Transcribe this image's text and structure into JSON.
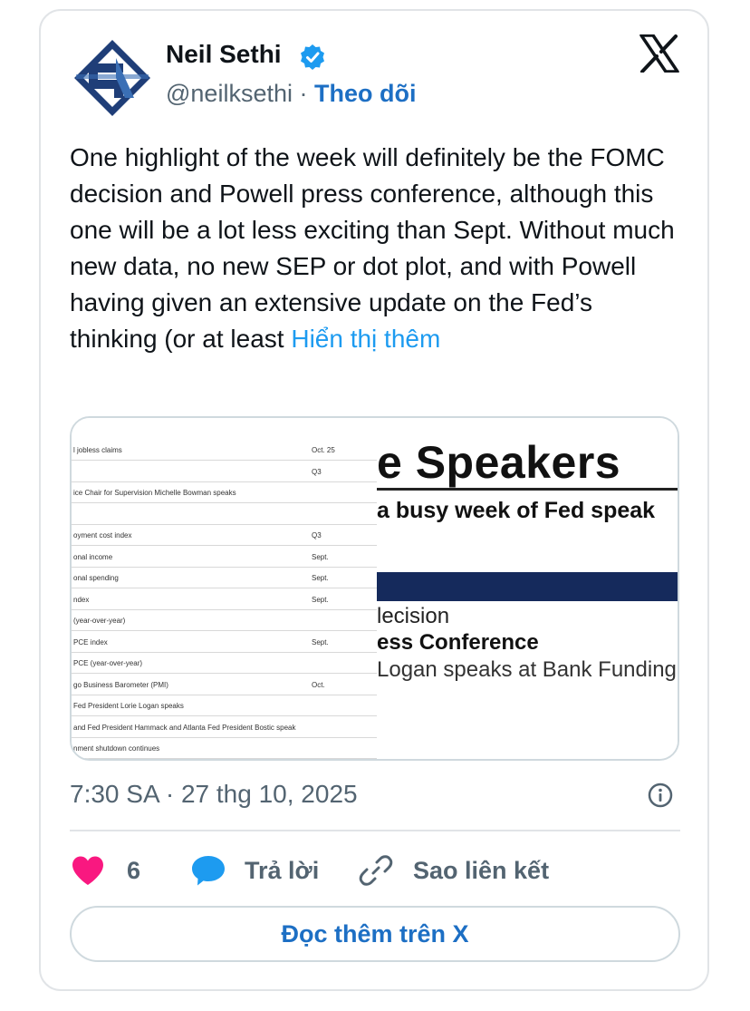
{
  "author": {
    "name": "Neil Sethi",
    "handle": "@neilksethi",
    "separator": "·",
    "follow_label": "Theo dõi"
  },
  "tweet": {
    "text": "One highlight of the week will definitely be the FOMC decision and Powell press conference, although this one will be a lot less exciting than Sept. Without much new data, no new SEP or dot plot, and with Powell having given an extensive update on the Fed’s thinking (or at least ",
    "show_more": "Hiển thị thêm"
  },
  "media": {
    "table_rows": [
      {
        "label": "l jobless claims",
        "period": "Oct. 25"
      },
      {
        "label": "",
        "period": "Q3"
      },
      {
        "label": "ice Chair for Supervision Michelle Bowman speaks",
        "period": ""
      },
      {
        "label": "",
        "period": ""
      },
      {
        "label": "oyment cost index",
        "period": "Q3"
      },
      {
        "label": "onal income",
        "period": "Sept."
      },
      {
        "label": "onal spending",
        "period": "Sept."
      },
      {
        "label": "ndex",
        "period": "Sept."
      },
      {
        "label": "(year-over-year)",
        "period": ""
      },
      {
        "label": "PCE index",
        "period": "Sept."
      },
      {
        "label": "PCE (year-over-year)",
        "period": ""
      },
      {
        "label": "go Business Barometer (PMI)",
        "period": "Oct."
      },
      {
        "label": "Fed President Lorie Logan speaks",
        "period": ""
      },
      {
        "label": "and Fed President Hammack and Atlanta Fed President Bostic speak",
        "period": ""
      },
      {
        "label": "nment shutdown continues",
        "period": ""
      }
    ],
    "right_title": "e Speakers",
    "right_subtitle": "a busy week of Fed speak",
    "right_event1": "lecision",
    "right_event2": "ess Conference",
    "right_event3": "Logan speaks at Bank Funding Co"
  },
  "meta": {
    "timestamp": "7:30 SA · 27 thg 10, 2025"
  },
  "actions": {
    "likes": "6",
    "reply_label": "Trả lời",
    "copy_label": "Sao liên kết"
  },
  "read_more_label": "Đọc thêm trên X",
  "colors": {
    "accent": "#1d6fc4",
    "link": "#1d9bf0",
    "heart": "#f91880",
    "navy_bar": "#152a5c"
  }
}
